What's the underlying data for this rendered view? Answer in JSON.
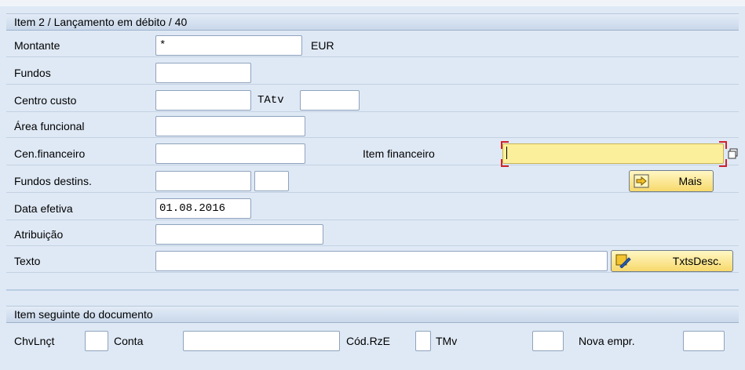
{
  "header1": "Item 2 / Lançamento em débito / 40",
  "fields": {
    "montante_label": "Montante",
    "montante_value": "*",
    "currency": "EUR",
    "fundos_label": "Fundos",
    "centro_custo_label": "Centro custo",
    "tatv_label": "TAtv",
    "area_funcional_label": "Área funcional",
    "cen_financeiro_label": "Cen.financeiro",
    "item_financeiro_label": "Item financeiro",
    "fundos_destins_label": "Fundos destins.",
    "data_efetiva_label": "Data efetiva",
    "data_efetiva_value": "01.08.2016",
    "atribuicao_label": "Atribuição",
    "texto_label": "Texto"
  },
  "buttons": {
    "mais": "Mais",
    "txtsdesc": "TxtsDesc."
  },
  "header2": "Item seguinte do documento",
  "next_item": {
    "chvlnct_label": "ChvLnçt",
    "conta_label": "Conta",
    "codrze_label": "Cód.RzE",
    "tmv_label": "TMv",
    "nova_empr_label": "Nova empr."
  }
}
